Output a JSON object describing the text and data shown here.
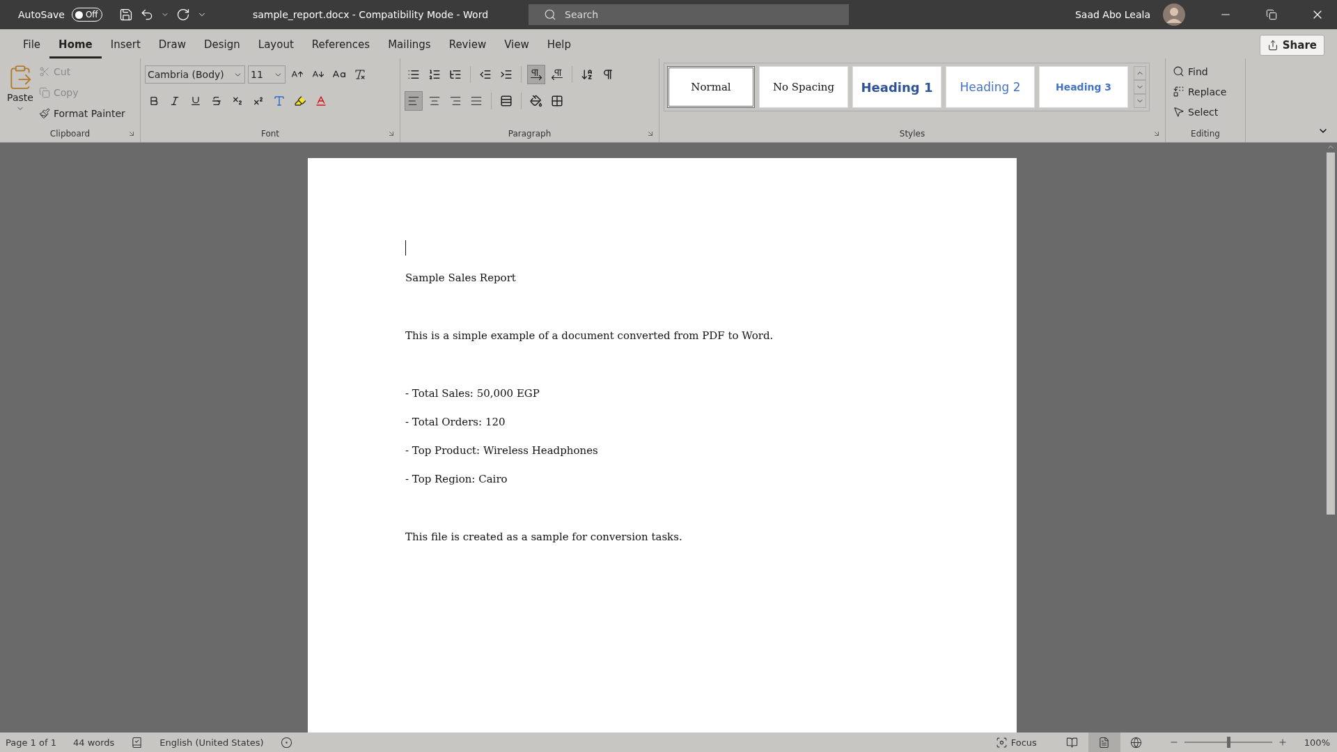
{
  "title_bar": {
    "autosave": {
      "label": "AutoSave",
      "on": false,
      "state_text": "Off"
    },
    "document_title": "sample_report.docx  -  Compatibility Mode  -  Word",
    "search": {
      "placeholder": "Search"
    },
    "user_name": "Saad Abo Leala"
  },
  "menu_tabs": [
    {
      "label": "File",
      "selected": false
    },
    {
      "label": "Home",
      "selected": true
    },
    {
      "label": "Insert",
      "selected": false
    },
    {
      "label": "Draw",
      "selected": false
    },
    {
      "label": "Design",
      "selected": false
    },
    {
      "label": "Layout",
      "selected": false
    },
    {
      "label": "References",
      "selected": false
    },
    {
      "label": "Mailings",
      "selected": false
    },
    {
      "label": "Review",
      "selected": false
    },
    {
      "label": "View",
      "selected": false
    },
    {
      "label": "Help",
      "selected": false
    }
  ],
  "share": "Share",
  "clipboard": {
    "label": "Clipboard",
    "paste": "Paste",
    "items": [
      {
        "kind": "cut",
        "label": "Cut",
        "disabled": true
      },
      {
        "kind": "copy",
        "label": "Copy",
        "disabled": true
      },
      {
        "kind": "painter",
        "label": "Format Painter",
        "disabled": false
      }
    ]
  },
  "font": {
    "label": "Font",
    "font_name": "Cambria (Body)",
    "font_size": "11"
  },
  "paragraph": {
    "label": "Paragraph",
    "direction": [
      {
        "kind": "ltr",
        "selected": true
      },
      {
        "kind": "rtl",
        "selected": false
      }
    ],
    "alignment": [
      {
        "kind": "left",
        "selected": true
      },
      {
        "kind": "center",
        "selected": false
      },
      {
        "kind": "right",
        "selected": false
      },
      {
        "kind": "justify",
        "selected": false
      }
    ]
  },
  "styles": {
    "label": "Styles",
    "items": [
      {
        "label": "Normal",
        "kind": "normal",
        "selected": true
      },
      {
        "label": "No Spacing",
        "kind": "normal",
        "selected": false
      },
      {
        "label": "Heading 1",
        "kind": "h1",
        "selected": false
      },
      {
        "label": "Heading 2",
        "kind": "h2",
        "selected": false
      },
      {
        "label": "Heading 3",
        "kind": "h3",
        "selected": false
      }
    ]
  },
  "editing": {
    "label": "Editing",
    "items": [
      {
        "kind": "find",
        "label": "Find"
      },
      {
        "kind": "replace",
        "label": "Replace"
      },
      {
        "kind": "select",
        "label": "Select"
      }
    ]
  },
  "document": {
    "sections": [
      {
        "lines": [
          "Sample Sales Report"
        ]
      },
      {
        "lines": [
          "This is a simple example of a document converted from PDF to Word."
        ]
      },
      {
        "lines": [
          "- Total Sales: 50,000 EGP",
          "- Total Orders: 120",
          "- Top Product: Wireless Headphones",
          "- Top Region: Cairo"
        ]
      },
      {
        "lines": [
          "This file is created as a sample for conversion tasks."
        ]
      }
    ]
  },
  "status_bar": {
    "page": "Page 1 of 1",
    "words": "44 words",
    "language": "English (United States)",
    "focus": "Focus",
    "views": [
      {
        "kind": "read",
        "selected": false
      },
      {
        "kind": "print",
        "selected": true
      },
      {
        "kind": "web",
        "selected": false
      }
    ],
    "zoom": {
      "level": 0.5,
      "text": "100%"
    }
  }
}
